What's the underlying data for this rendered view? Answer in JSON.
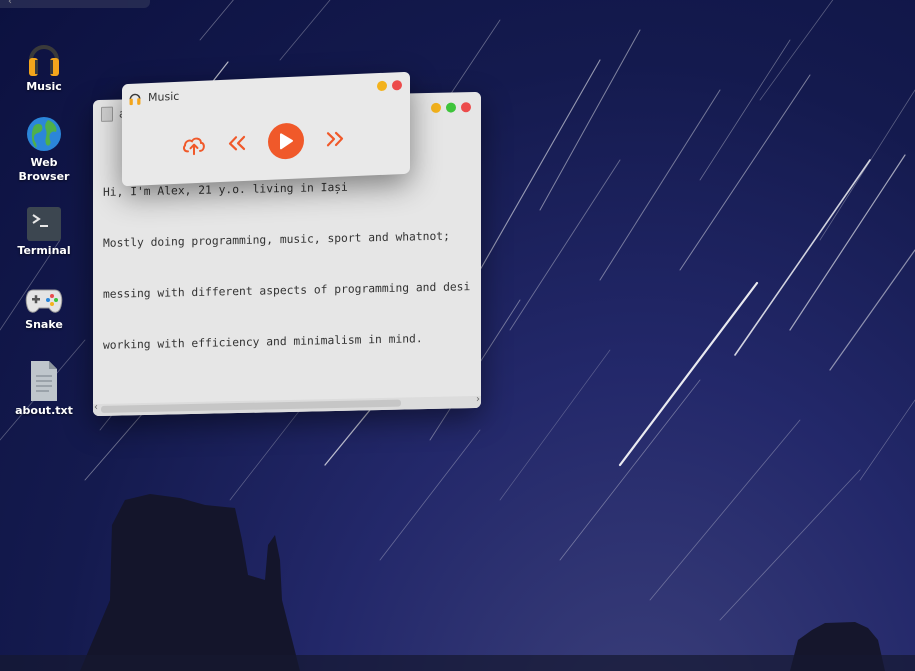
{
  "desktop": {
    "icons": [
      {
        "id": "music",
        "label": "Music",
        "icon": "headphones-icon"
      },
      {
        "id": "web-browser",
        "label": "Web\nBrowser",
        "icon": "globe-icon"
      },
      {
        "id": "terminal",
        "label": "Terminal",
        "icon": "terminal-icon"
      },
      {
        "id": "snake",
        "label": "Snake",
        "icon": "gamepad-icon"
      },
      {
        "id": "about",
        "label": "about.txt",
        "icon": "text-file-icon"
      }
    ]
  },
  "editor": {
    "title": "a",
    "lines": [
      "Hi, I'm Alex, 21 y.o. living in Iași",
      "Mostly doing programming, music, sport and whatnot;",
      "messing with different aspects of programming and desi",
      "working with efficiency and minimalism in mind."
    ]
  },
  "music_player": {
    "title": "Music",
    "controls": {
      "upload": "upload-icon",
      "previous": "rewind-icon",
      "play": "play-icon",
      "next": "fast-forward-icon"
    }
  },
  "colors": {
    "accent": "#f0592a",
    "close": "#ec4b4b",
    "minimize": "#f3b21c",
    "maximize": "#3ec43b"
  }
}
